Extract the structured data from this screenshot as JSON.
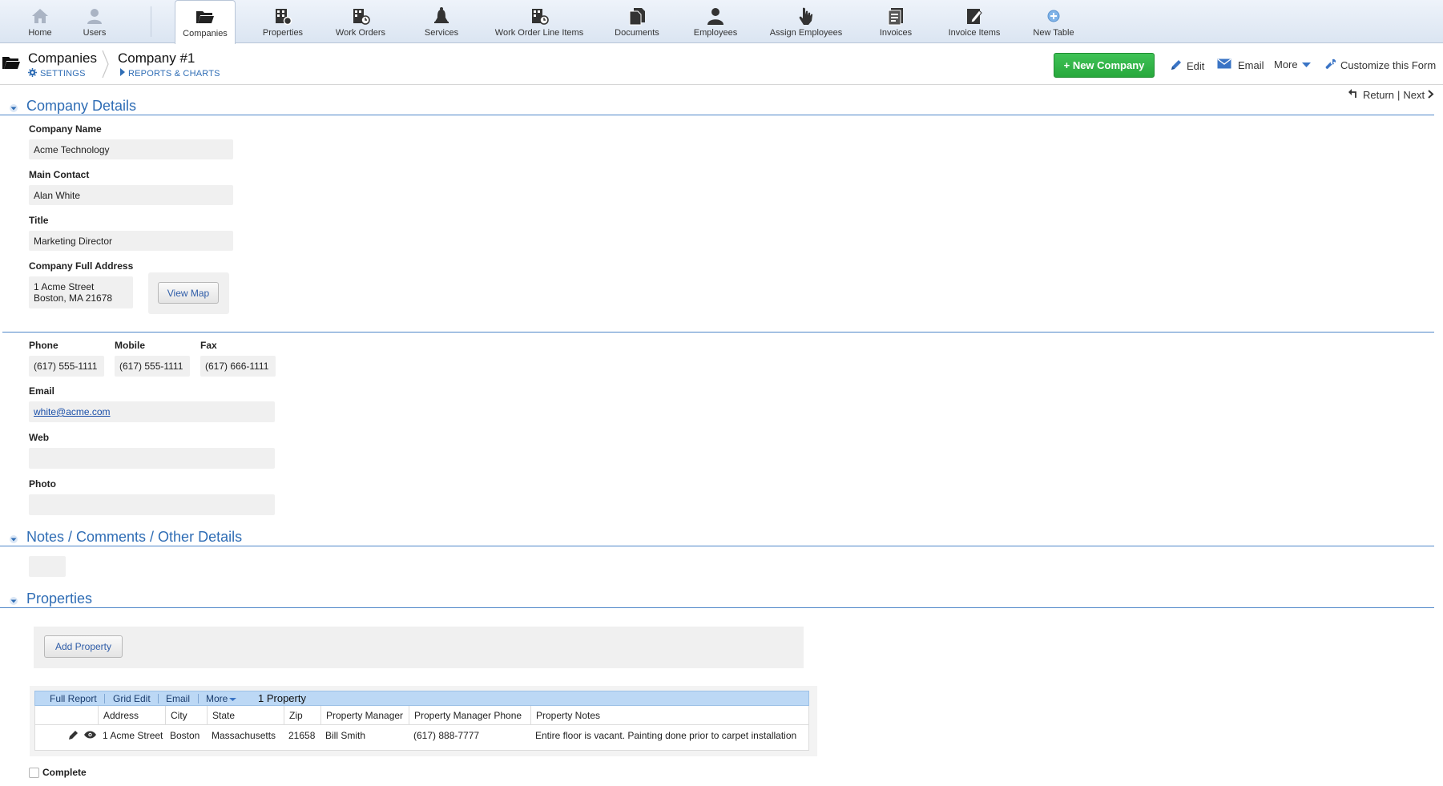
{
  "nav": {
    "items": [
      {
        "label": "Home",
        "icon": "home-icon"
      },
      {
        "label": "Users",
        "icon": "user-icon"
      },
      {
        "label": "Companies",
        "icon": "folder-icon",
        "active": true
      },
      {
        "label": "Properties",
        "icon": "building-gear-icon"
      },
      {
        "label": "Work Orders",
        "icon": "building-clock-icon"
      },
      {
        "label": "Services",
        "icon": "bell-icon"
      },
      {
        "label": "Work Order Line Items",
        "icon": "building-clock-icon"
      },
      {
        "label": "Documents",
        "icon": "documents-icon"
      },
      {
        "label": "Employees",
        "icon": "person-icon"
      },
      {
        "label": "Assign Employees",
        "icon": "hand-pointer-icon"
      },
      {
        "label": "Invoices",
        "icon": "invoice-icon"
      },
      {
        "label": "Invoice Items",
        "icon": "invoice-edit-icon"
      },
      {
        "label": "New Table",
        "icon": "plus-circle-icon"
      }
    ]
  },
  "header": {
    "table_name": "Companies",
    "settings_label": "SETTINGS",
    "record_title": "Company #1",
    "reports_label": "REPORTS & CHARTS",
    "new_button_label": "+ New Company",
    "edit_label": "Edit",
    "email_label": "Email",
    "more_label": "More",
    "customize_label": "Customize this Form",
    "return_label": "Return",
    "next_label": "Next",
    "return_next_sep": "|"
  },
  "company_details": {
    "section_title": "Company Details",
    "company_name_label": "Company Name",
    "company_name": "Acme Technology",
    "main_contact_label": "Main Contact",
    "main_contact": "Alan White",
    "title_label": "Title",
    "title": "Marketing Director",
    "address_label": "Company Full Address",
    "address_line1": "1 Acme Street",
    "address_line2": "Boston, MA 21678",
    "view_map_label": "View Map",
    "phone_label": "Phone",
    "phone": "(617) 555-1111",
    "mobile_label": "Mobile",
    "mobile": "(617) 555-1111",
    "fax_label": "Fax",
    "fax": "(617) 666-1111",
    "email_label": "Email",
    "email": "white@acme.com",
    "web_label": "Web",
    "web": "",
    "photo_label": "Photo"
  },
  "notes": {
    "section_title": "Notes / Comments / Other Details",
    "value": ""
  },
  "properties": {
    "section_title": "Properties",
    "add_button_label": "Add  Property",
    "toolbar": {
      "full_report": "Full Report",
      "grid_edit": "Grid Edit",
      "email": "Email",
      "more": "More",
      "count": "1 Property"
    },
    "columns": [
      "Address",
      "City",
      "State",
      "Zip",
      "Property Manager",
      "Property Manager Phone",
      "Property Notes"
    ],
    "rows": [
      {
        "address": "1 Acme Street",
        "city": "Boston",
        "state": "Massachusetts",
        "zip": "21658",
        "manager": "Bill Smith",
        "manager_phone": "(617) 888-7777",
        "notes": "Entire floor is vacant.  Painting done prior to carpet installation"
      }
    ]
  },
  "complete_label": "Complete",
  "colors": {
    "accent_blue": "#2f6db5",
    "green_button": "#2fb547",
    "grid_toolbar": "#bcd8f5"
  }
}
